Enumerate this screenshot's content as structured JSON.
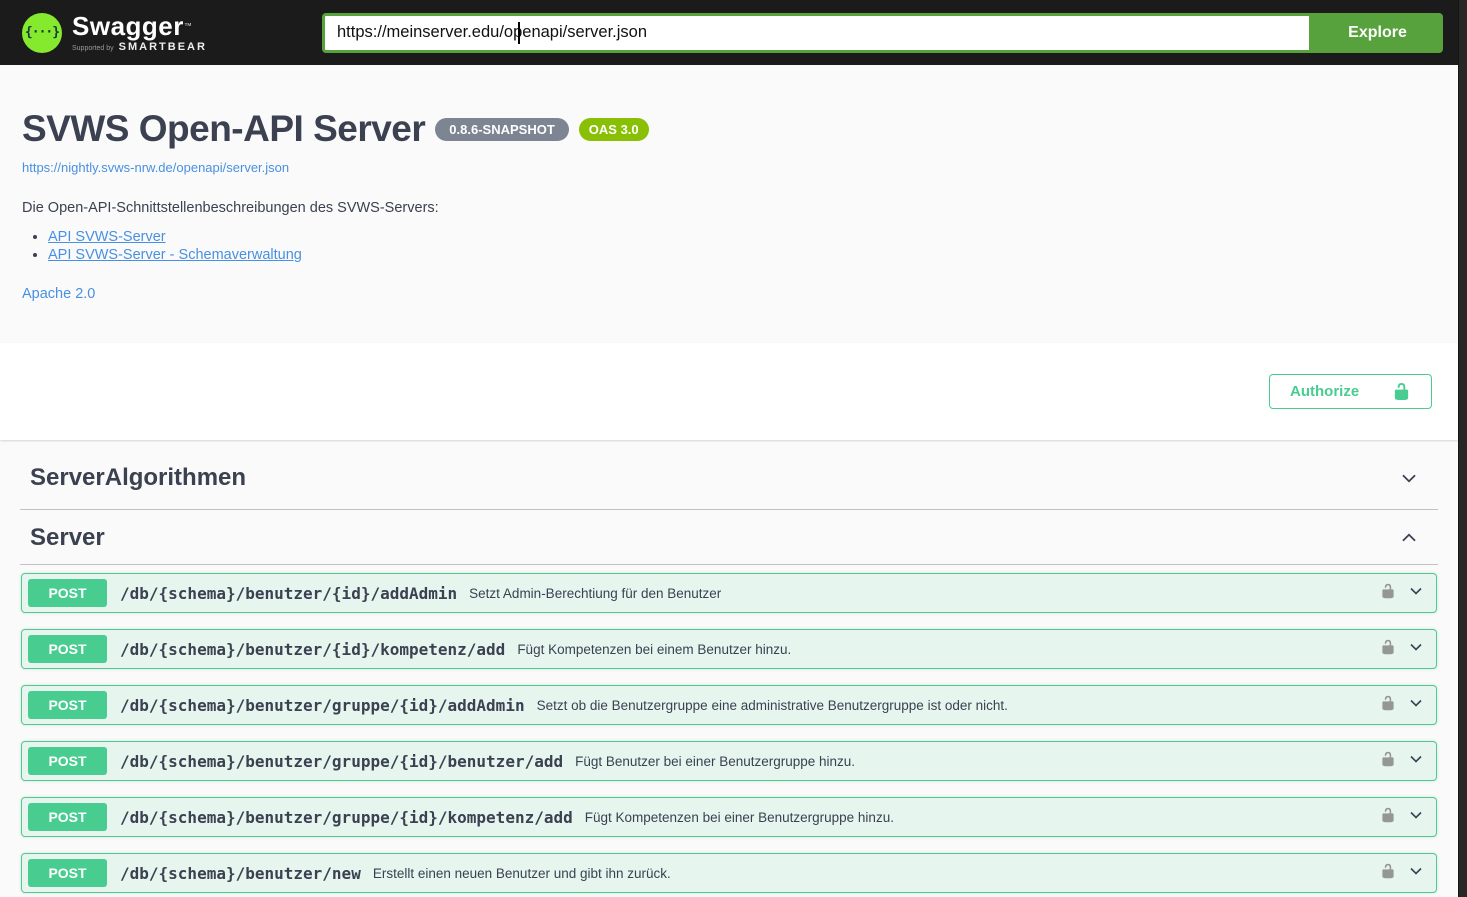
{
  "topbar": {
    "logo_glyph": "{···}",
    "logo_text": "Swagger",
    "logo_tm": "™",
    "supported_by": "Supported by",
    "smartbear": "SMARTBEAR",
    "url_value": "https://meinserver.edu/openapi/server.json",
    "explore_label": "Explore"
  },
  "info": {
    "title": "SVWS Open-API Server",
    "version_badge": "0.8.6-SNAPSHOT",
    "oas_badge": "OAS 3.0",
    "spec_url": "https://nightly.svws-nrw.de/openapi/server.json",
    "description": "Die Open-API-Schnittstellenbeschreibungen des SVWS-Servers:",
    "link_1": "API SVWS-Server",
    "link_2": "API SVWS-Server - Schemaverwaltung",
    "license": "Apache 2.0"
  },
  "auth": {
    "authorize_label": "Authorize"
  },
  "sections": [
    {
      "title": "ServerAlgorithmen",
      "expanded": false,
      "operations": []
    },
    {
      "title": "Server",
      "expanded": true,
      "operations": [
        {
          "method": "POST",
          "path": "/db/{schema}/benutzer/{id}/addAdmin",
          "summary": "Setzt Admin-Berechtiung für den Benutzer"
        },
        {
          "method": "POST",
          "path": "/db/{schema}/benutzer/{id}/kompetenz/add",
          "summary": "Fügt Kompetenzen bei einem Benutzer hinzu."
        },
        {
          "method": "POST",
          "path": "/db/{schema}/benutzer/gruppe/{id}/addAdmin",
          "summary": "Setzt ob die Benutzergruppe eine administrative Benutzergruppe ist oder nicht."
        },
        {
          "method": "POST",
          "path": "/db/{schema}/benutzer/gruppe/{id}/benutzer/add",
          "summary": "Fügt Benutzer bei einer Benutzergruppe hinzu."
        },
        {
          "method": "POST",
          "path": "/db/{schema}/benutzer/gruppe/{id}/kompetenz/add",
          "summary": "Fügt Kompetenzen bei einer Benutzergruppe hinzu."
        },
        {
          "method": "POST",
          "path": "/db/{schema}/benutzer/new",
          "summary": "Erstellt einen neuen Benutzer und gibt ihn zurück."
        }
      ]
    }
  ],
  "colors": {
    "topbar_bg": "#1b1b1b",
    "logo_green": "#85ea2d",
    "explore_green": "#58a23d",
    "post_green": "#49cc90",
    "oas_green": "#89bf04",
    "version_gray": "#7d8492",
    "link_blue": "#4990e2",
    "text_dark": "#3b4151",
    "page_bg": "#fafafa"
  }
}
